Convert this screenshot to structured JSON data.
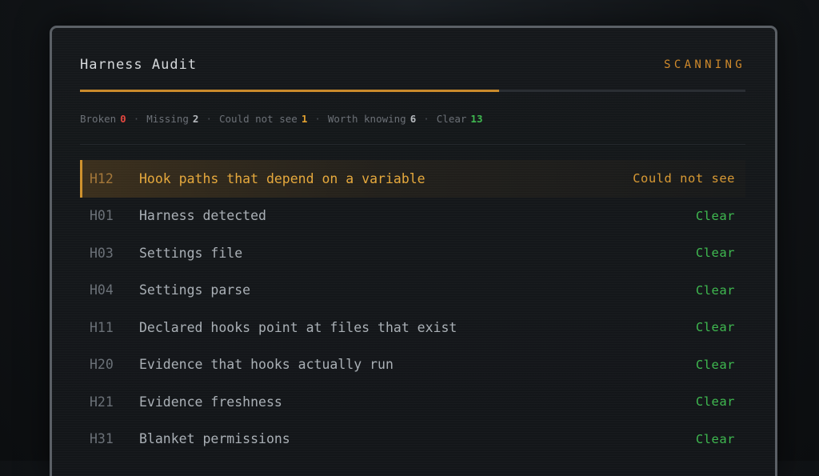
{
  "header": {
    "title": "Harness Audit",
    "status": "SCANNING"
  },
  "progress": {
    "fraction": 0.63
  },
  "summary": [
    {
      "label": "Broken",
      "count": "0",
      "color": "#e2473f"
    },
    {
      "label": "Missing",
      "count": "2",
      "color": "#b5b9bd"
    },
    {
      "label": "Could not see",
      "count": "1",
      "color": "#e0a030"
    },
    {
      "label": "Worth knowing",
      "count": "6",
      "color": "#b5b9bd"
    },
    {
      "label": "Clear",
      "count": "13",
      "color": "#3fb950"
    }
  ],
  "rows": [
    {
      "code": "H12",
      "name": "Hook paths that depend on a variable",
      "result": "Could not see",
      "highlight": true
    },
    {
      "code": "H01",
      "name": "Harness detected",
      "result": "Clear",
      "highlight": false
    },
    {
      "code": "H03",
      "name": "Settings file",
      "result": "Clear",
      "highlight": false
    },
    {
      "code": "H04",
      "name": "Settings parse",
      "result": "Clear",
      "highlight": false
    },
    {
      "code": "H11",
      "name": "Declared hooks point at files that exist",
      "result": "Clear",
      "highlight": false
    },
    {
      "code": "H20",
      "name": "Evidence that hooks actually run",
      "result": "Clear",
      "highlight": false
    },
    {
      "code": "H21",
      "name": "Evidence freshness",
      "result": "Clear",
      "highlight": false
    },
    {
      "code": "H31",
      "name": "Blanket permissions",
      "result": "Clear",
      "highlight": false
    }
  ],
  "colors": {
    "accent": "#d08a2c",
    "clear": "#3fb950",
    "broken": "#e2473f"
  }
}
